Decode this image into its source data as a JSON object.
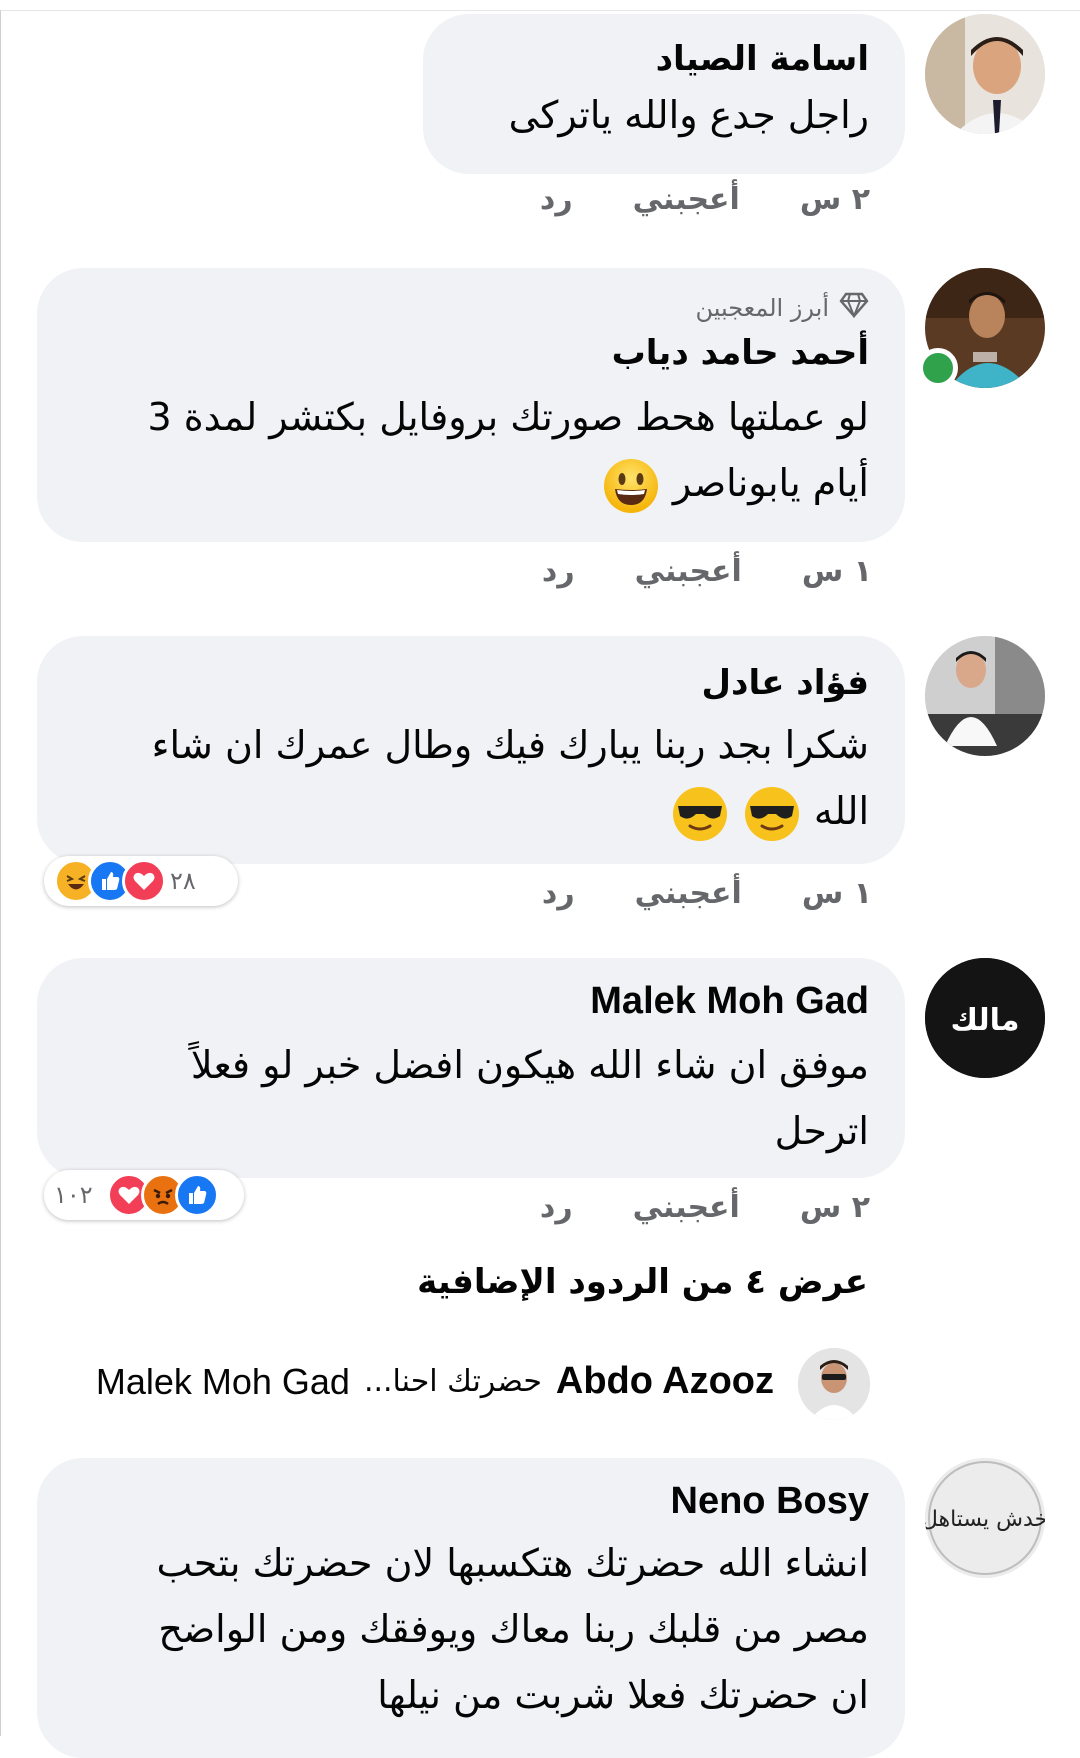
{
  "comments": [
    {
      "author": "اسامة الصياد",
      "text": "راجل جدع والله ياتركى",
      "time": "٢ س",
      "like_label": "أعجبني",
      "reply_label": "رد"
    },
    {
      "badge": "أبرز المعجبين",
      "badge_icon": "diamond-icon",
      "author": "أحمد حامد دياب",
      "text_line1": "لو عملتها هحط صورتك بروفايل بكتشر لمدة 3",
      "text_line2": "أيام يابوناصر",
      "emoji": "grinning-face",
      "online": true,
      "time": "١ س",
      "like_label": "أعجبني",
      "reply_label": "رد"
    },
    {
      "author": "فؤاد عادل",
      "text_line1": "شكرا بجد ربنا يبارك فيك وطال عمرك ان شاء",
      "text_line2": "الله",
      "emoji": "sunglasses-face",
      "time": "١ س",
      "like_label": "أعجبني",
      "reply_label": "رد",
      "reactions": [
        "haha",
        "like",
        "love"
      ],
      "reaction_count": "٢٨"
    },
    {
      "author": "Malek Moh Gad",
      "avatar_text": "مالك",
      "text_line1": "موفق ان شاء الله هيكون افضل خبر لو فعلاً",
      "text_line2": "اترحل",
      "time": "٢ س",
      "like_label": "أعجبني",
      "reply_label": "رد",
      "reactions": [
        "like",
        "angry",
        "love"
      ],
      "reaction_count": "١٠٢"
    }
  ],
  "more_replies": "عرض ٤ من الردود الإضافية",
  "reply_preview": {
    "author": "Abdo Azooz",
    "text": "حضرتك احنا...",
    "target": "Malek Moh Gad"
  },
  "last_comment": {
    "author": "Neno Bosy",
    "avatar_text": "خدش يستاهل",
    "line1": "انشاء الله حضرتك هتكسبها لان حضرتك بتحب",
    "line2": "مصر من قلبك ربنا معاك ويوفقك ومن الواضح",
    "line3": "ان حضرتك فعلا شربت من نيلها"
  },
  "colors": {
    "bubble": "#f0f2f5",
    "secondary_text": "#65676b",
    "online": "#31a24c",
    "like": "#1877f2",
    "love": "#f33e58"
  }
}
